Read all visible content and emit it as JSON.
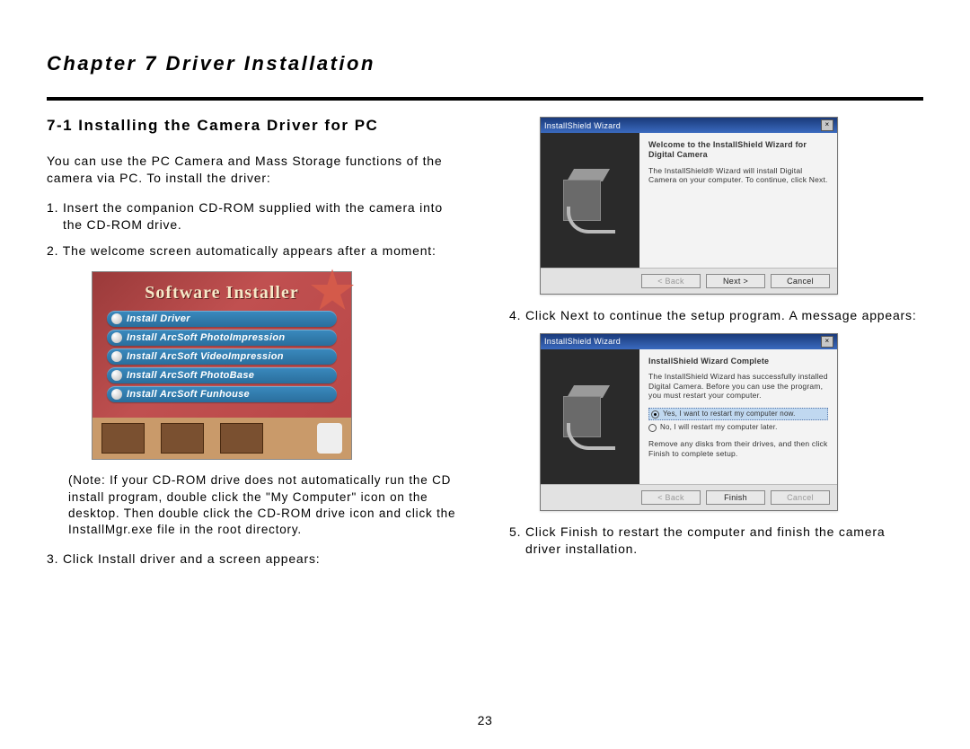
{
  "chapter_title": "Chapter 7 Driver Installation",
  "section_title": "7-1 Installing the Camera Driver for PC",
  "intro": "You can use the PC Camera and Mass Storage functions of the camera via PC. To install the driver:",
  "step1": "1. Insert the companion CD-ROM supplied with the camera into the CD-ROM drive.",
  "step2": "2. The welcome screen automatically appears after a moment:",
  "note": "(Note: If your CD-ROM drive does not automatically run the CD install program, double click the \"My Computer\" icon on the desktop. Then double click the CD-ROM drive icon and click the InstallMgr.exe file in the root directory.",
  "step3": "3. Click Install driver and a screen appears:",
  "step4": "4. Click Next to continue the setup program. A message appears:",
  "step5": "5. Click Finish to restart the computer and finish the camera driver installation.",
  "page_number": "23",
  "installer": {
    "title": "Software Installer",
    "items": [
      "Install Driver",
      "Install ArcSoft PhotoImpression",
      "Install ArcSoft VideoImpression",
      "Install ArcSoft PhotoBase",
      "Install ArcSoft Funhouse"
    ]
  },
  "wizard1": {
    "titlebar": "InstallShield Wizard",
    "heading": "Welcome to the InstallShield Wizard for Digital Camera",
    "body": "The InstallShield® Wizard will install Digital Camera on your computer. To continue, click Next.",
    "back": "< Back",
    "next": "Next >",
    "cancel": "Cancel"
  },
  "wizard2": {
    "titlebar": "InstallShield Wizard",
    "heading": "InstallShield Wizard Complete",
    "body": "The InstallShield Wizard has successfully installed Digital Camera. Before you can use the program, you must restart your computer.",
    "opt1": "Yes, I want to restart my computer now.",
    "opt2": "No, I will restart my computer later.",
    "body2": "Remove any disks from their drives, and then click Finish to complete setup.",
    "back": "< Back",
    "finish": "Finish",
    "cancel": "Cancel"
  }
}
